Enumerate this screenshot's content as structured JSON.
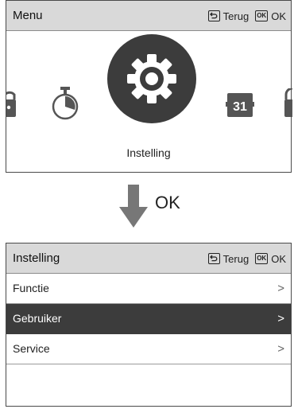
{
  "menu_screen": {
    "header": {
      "title": "Menu",
      "back_label": "Terug",
      "ok_key": "OK",
      "ok_label": "OK"
    },
    "items": [
      {
        "name": "lock",
        "icon": "lock-icon",
        "selected": false
      },
      {
        "name": "timer",
        "icon": "stopwatch-icon",
        "selected": false
      },
      {
        "name": "settings",
        "icon": "gear-icon",
        "selected": true
      },
      {
        "name": "calendar",
        "icon": "calendar-icon",
        "selected": false,
        "text": "31"
      },
      {
        "name": "lock",
        "icon": "lock-icon",
        "selected": false
      }
    ],
    "selected_label": "Instelling"
  },
  "transition": {
    "icon": "arrow-down-icon",
    "label": "OK"
  },
  "settings_screen": {
    "header": {
      "title": "Instelling",
      "back_label": "Terug",
      "ok_key": "OK",
      "ok_label": "OK"
    },
    "items": [
      {
        "label": "Functie",
        "selected": false
      },
      {
        "label": "Gebruiker",
        "selected": true
      },
      {
        "label": "Service",
        "selected": false
      }
    ]
  },
  "colors": {
    "header_bg": "#d9d9d9",
    "selected_bg": "#3c3c3c",
    "border": "#4a4a4a"
  }
}
